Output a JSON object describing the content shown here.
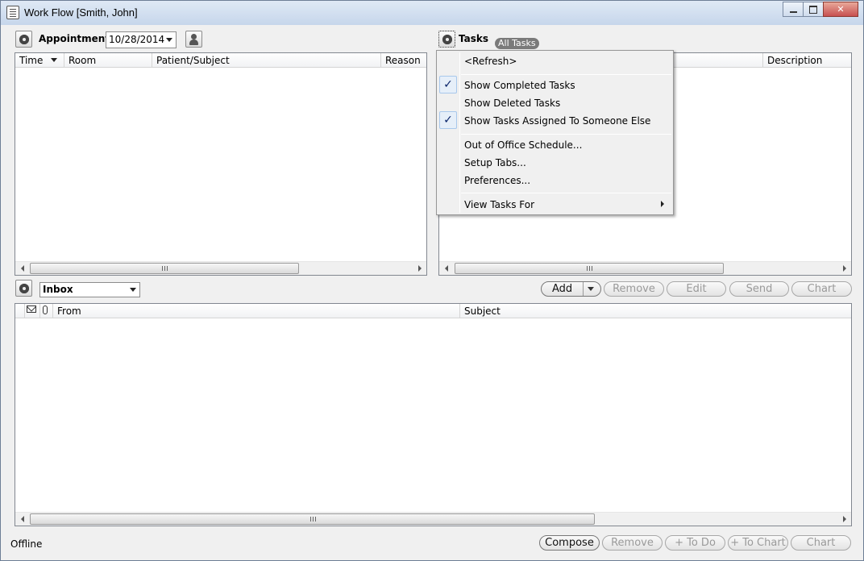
{
  "window": {
    "title": "Work Flow [Smith, John]"
  },
  "appointments": {
    "label": "Appointments",
    "date": "10/28/2014",
    "columns": [
      "Time",
      "Room",
      "Patient/Subject",
      "Reason"
    ]
  },
  "tasks": {
    "label": "Tasks",
    "tab": "All Tasks",
    "columns": [
      "Description"
    ]
  },
  "menu": {
    "items": [
      {
        "label": "<Refresh>",
        "checked": false
      },
      {
        "label": "Show Completed Tasks",
        "checked": true
      },
      {
        "label": "Show Deleted Tasks",
        "checked": false
      },
      {
        "label": "Show Tasks Assigned To Someone Else",
        "checked": true
      },
      {
        "label": "Out of Office Schedule...",
        "checked": false
      },
      {
        "label": "Setup Tabs...",
        "checked": false
      },
      {
        "label": "Preferences...",
        "checked": false
      },
      {
        "label": "View Tasks For",
        "checked": false,
        "submenu": true
      }
    ]
  },
  "task_buttons": {
    "add": "Add",
    "remove": "Remove",
    "edit": "Edit",
    "send": "Send",
    "chart": "Chart"
  },
  "inbox": {
    "folder": "Inbox",
    "columns": [
      "From",
      "Subject"
    ]
  },
  "bottom_buttons": {
    "compose": "Compose",
    "remove": "Remove",
    "to_do": "+ To Do",
    "to_chart": "+ To Chart",
    "chart": "Chart"
  },
  "status": "Offline"
}
